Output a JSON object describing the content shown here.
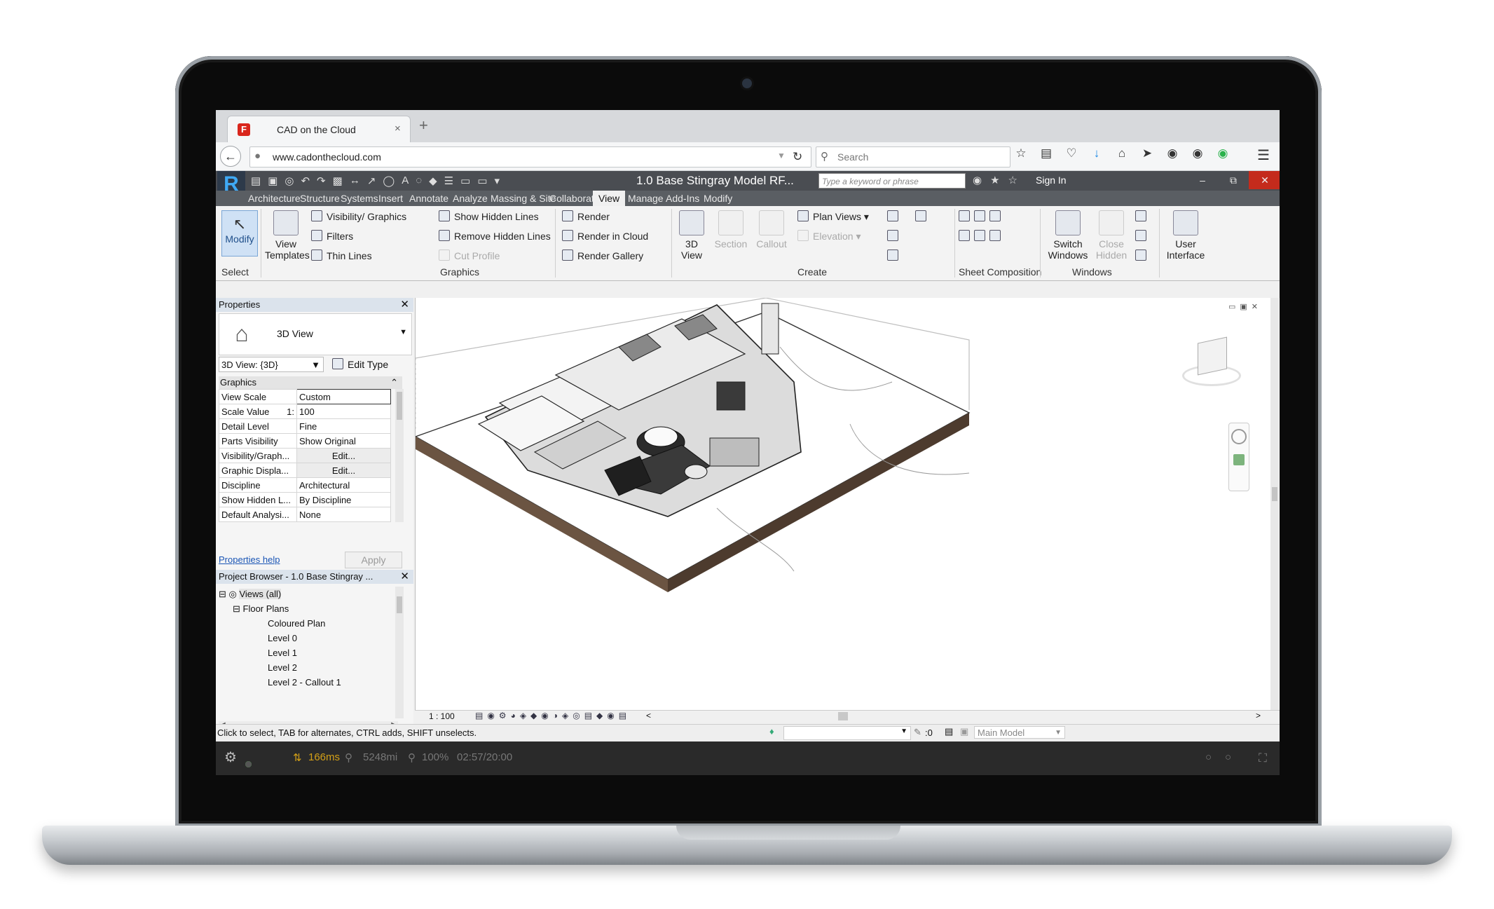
{
  "browser": {
    "tab_title": "CAD on the Cloud",
    "tab_close": "×",
    "new_tab": "+",
    "favicon": "F",
    "url": "www.cadonthecloud.com",
    "search_placeholder": "Search",
    "icons": [
      "star-icon",
      "clipboard-icon",
      "pocket-icon",
      "download-icon",
      "home-icon",
      "send-icon",
      "sync-icon",
      "chat-icon",
      "extension-icon"
    ]
  },
  "revit": {
    "doc_title": "1.0 Base Stingray Model RF...",
    "keyword_placeholder": "Type a keyword or phrase",
    "sign_in": "Sign In",
    "menu_tabs": [
      "Architecture",
      "Structure",
      "Systems",
      "Insert",
      "Annotate",
      "Analyze",
      "Massing & Site",
      "Collaborate",
      "View",
      "Manage",
      "Add-Ins",
      "Modify"
    ],
    "active_tab": "View",
    "ribbon": {
      "modify": "Modify",
      "select": "Select",
      "view_templates": [
        "View",
        "Templates"
      ],
      "graphics_items": [
        "Visibility/ Graphics",
        "Filters",
        "Thin Lines",
        "Show Hidden Lines",
        "Remove Hidden Lines",
        "Cut Profile"
      ],
      "render_items": [
        "Render",
        "Render in Cloud",
        "Render Gallery"
      ],
      "graphics_label": "Graphics",
      "create": {
        "view3d": [
          "3D",
          "View"
        ],
        "section": "Section",
        "callout": "Callout",
        "plan_views": "Plan Views",
        "elevation": "Elevation",
        "label": "Create"
      },
      "sheet_composition": "Sheet Composition",
      "switch_windows": [
        "Switch",
        "Windows"
      ],
      "close_hidden": [
        "Close",
        "Hidden"
      ],
      "user_interface": [
        "User",
        "Interface"
      ],
      "windows_label": "Windows"
    },
    "properties": {
      "title": "Properties",
      "type_name": "3D View",
      "view_selector": "3D View: {3D}",
      "edit_type": "Edit Type",
      "group": "Graphics",
      "rows": [
        {
          "k": "View Scale",
          "v": "Custom"
        },
        {
          "k": "Scale Value",
          "k2": "1:",
          "v": "100"
        },
        {
          "k": "Detail Level",
          "v": "Fine"
        },
        {
          "k": "Parts Visibility",
          "v": "Show Original"
        },
        {
          "k": "Visibility/Graph...",
          "v": "Edit..."
        },
        {
          "k": "Graphic Displa...",
          "v": "Edit..."
        },
        {
          "k": "Discipline",
          "v": "Architectural"
        },
        {
          "k": "Show Hidden L...",
          "v": "By Discipline"
        },
        {
          "k": "Default Analysi...",
          "v": "None"
        }
      ],
      "help": "Properties help",
      "apply": "Apply"
    },
    "browser_panel": {
      "title": "Project Browser - 1.0 Base Stingray ...",
      "items": [
        "Views (all)",
        "Floor Plans",
        "Coloured Plan",
        "Level 0",
        "Level 1",
        "Level 2",
        "Level 2 - Callout 1"
      ]
    },
    "view_scale": "1 : 100",
    "status_text": "Click to select, TAB for alternates, CTRL adds, SHIFT unselects.",
    "status_zero": ":0",
    "main_model": "Main Model"
  },
  "streaming": {
    "latency": "166ms",
    "distance": "5248mi",
    "zoom": "100%",
    "timer": "02:57/20:00"
  },
  "colors": {
    "revit_dark": "#4a4d52",
    "accent_blue": "#3fa9f5",
    "close_red": "#c42b1c",
    "slab_brown": "#6b5442"
  }
}
